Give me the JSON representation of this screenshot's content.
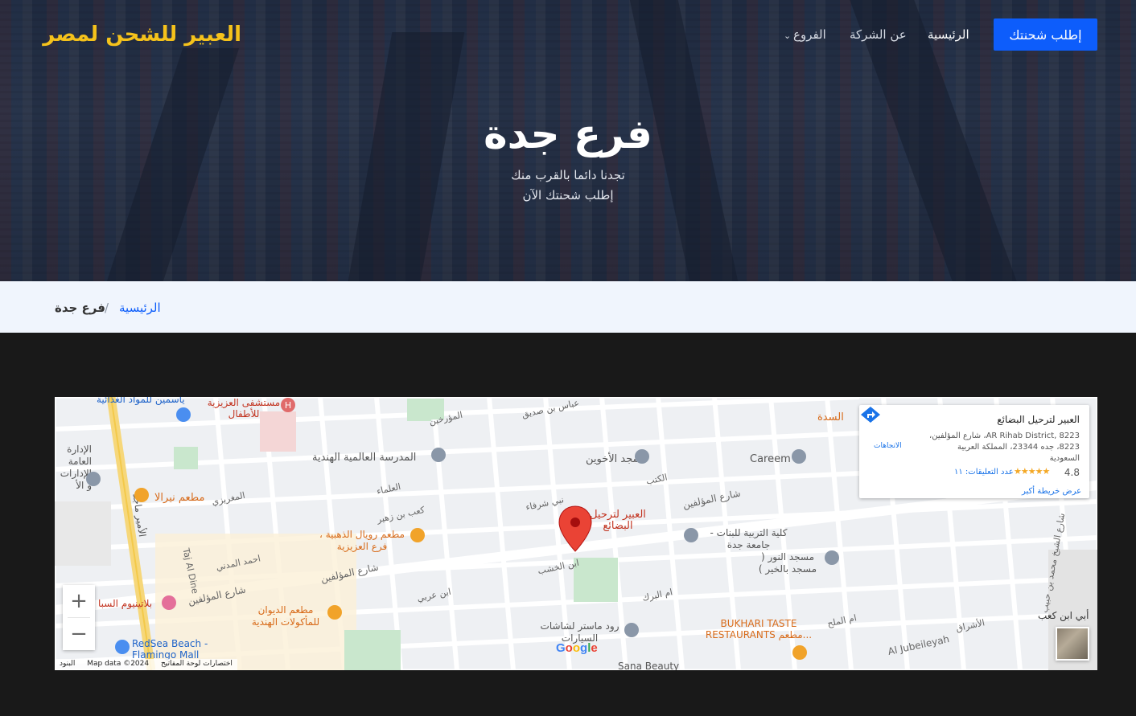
{
  "header": {
    "brand": "العبير للشحن لمصر",
    "nav": {
      "home": "الرئيسية",
      "about": "عن الشركة",
      "branches": "الفروع"
    },
    "cta": "إطلب شحنتك"
  },
  "hero": {
    "title": "فرع جدة",
    "line1": "تجدنا دائما بالقرب منك",
    "line2": "إطلب شحنتك الآن"
  },
  "breadcrumb": {
    "home": "الرئيسية",
    "separator": "/",
    "current": "فرع جدة"
  },
  "map": {
    "info": {
      "name": "العبير لترحيل البضائع",
      "address_line1": "AR Rihab District, 8223، شارع المؤلفين،",
      "address_line2": "8223، جده 23344، المملكة العربية السعودية",
      "rating": "4.8",
      "stars": "★★★★★",
      "reviews": "عدد التعليقات: ١١",
      "directions": "الاتجاهات",
      "view_larger": "عرض خريطة أكبر"
    },
    "zoom_in": "+",
    "zoom_out": "−",
    "attribution": {
      "terms": "البنود",
      "data": "Map data ©2024",
      "shortcuts": "اختصارات لوحة المفاتيح"
    },
    "google": "Google",
    "marker_label": "العبير لترحيل البضائع",
    "places": {
      "p1": "مستشفى العزيزية للأطفال",
      "p2": "ياسمين للمواد الغذائية",
      "p3": "المدرسة العالمية الهندية",
      "p4": "مسجد الأخوين",
      "p5": "Careem",
      "p6": "مطعم نيرالا",
      "p7": "مطعم رويال الذهبية ، فرع العزيزية",
      "p8": "كلية التربية للبنات - جامعة جدة",
      "p9": "مسجد النور ( مسجد بالخير )",
      "p10": "بلاتينيوم السبا",
      "p11": "مطعم الديوان للمأكولات الهندية",
      "p12": "RedSea Beach - Flamingo Mall",
      "p13": "رود ماستر لشاشات السيارات",
      "p14": "BUKHARI TASTE RESTAURANTS مطعم...",
      "p15": "Sana Beauty",
      "p16": "الإدارة العامة الإدارات و الأ",
      "p17": "السدة"
    },
    "streets": {
      "s1": "شارع المؤلفين",
      "s2": "شارع المؤلفين",
      "s3": "شارع المؤلفين",
      "s4": "الأمير ماجد",
      "s5": "Taj Al Dine",
      "s6": "Al Jubeileyah",
      "s7": "كعب بن زهير",
      "s8": "نبي شرفاء",
      "s9": "ابن الخشب",
      "s10": "ام البرك",
      "s11": "ابن عربي",
      "s12": "الأشراق",
      "s13": "أبي ابن كعب",
      "s14": "شارع الشيخ محمد بن حبيب",
      "s15": "عباس بن صديق",
      "s16": "الكتب",
      "s17": "المغريزي",
      "s18": "المؤرخين",
      "s19": "العلماء",
      "s20": "احمد المدني",
      "s21": "ام الملح"
    }
  },
  "colors": {
    "brand": "#f5c21b",
    "primary": "#0d5dfb",
    "footer_bg": "#191919",
    "breadcrumb_bg": "#f0f5fd"
  }
}
